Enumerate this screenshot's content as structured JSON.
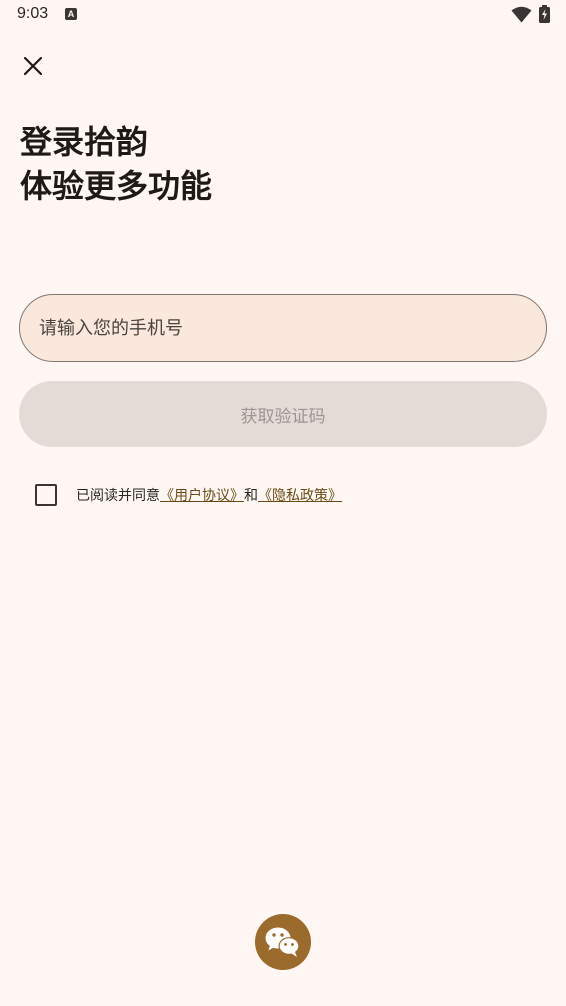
{
  "status_bar": {
    "time": "9:03",
    "notification_icon": "a-badge-icon",
    "wifi_icon": "wifi-icon",
    "battery_icon": "battery-charging-icon"
  },
  "header": {
    "close_icon": "close-icon"
  },
  "title": {
    "line1": "登录拾韵",
    "line2": "体验更多功能"
  },
  "form": {
    "phone_placeholder": "请输入您的手机号",
    "get_code_label": "获取验证码"
  },
  "agreement": {
    "checked": false,
    "prefix": "已阅读并同意",
    "user_agreement": "《用户协议》",
    "conjunction": "和",
    "privacy_policy": "《隐私政策》"
  },
  "social_login": {
    "wechat_icon": "wechat-icon"
  },
  "colors": {
    "background": "#fff7f3",
    "input_fill": "#f9e8db",
    "button_disabled": "#e4dbd6",
    "accent": "#9a6b2c",
    "link": "#6b4a16"
  }
}
